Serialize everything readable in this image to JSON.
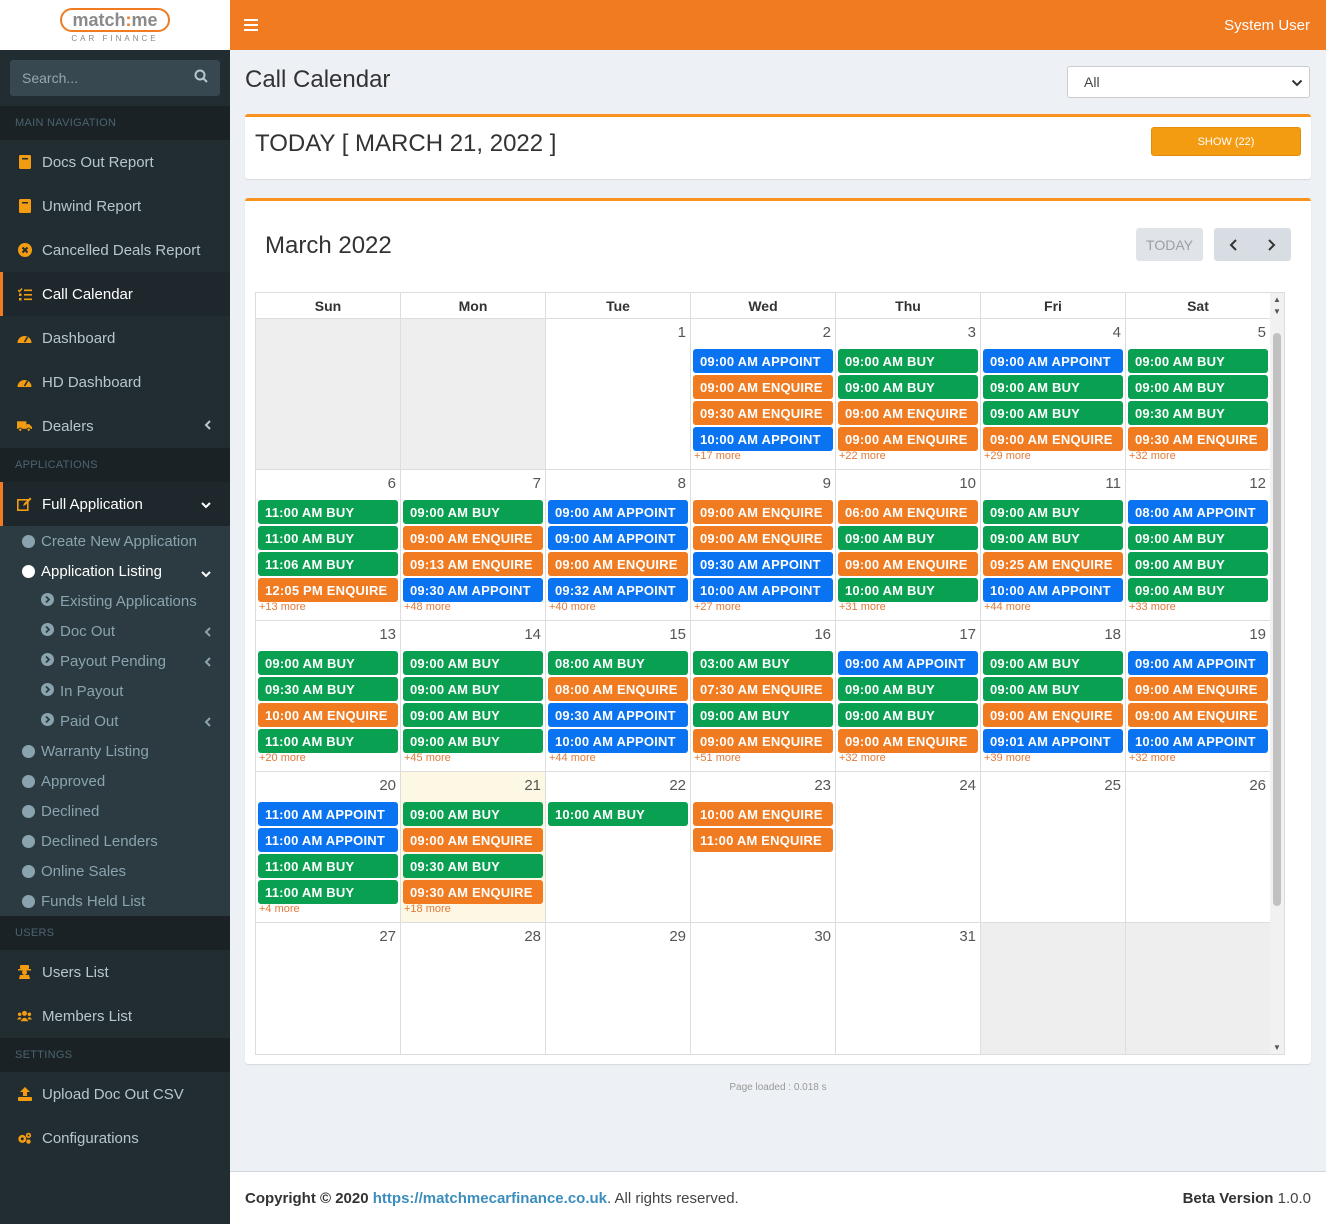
{
  "brand": {
    "name_left": "match",
    "name_colon": ":",
    "name_right": "me",
    "tagline": "CAR FINANCE"
  },
  "header": {
    "menu_icon": "hamburger-icon",
    "user": "System User"
  },
  "sidebar": {
    "search_placeholder": "Search...",
    "sections": {
      "main": "MAIN NAVIGATION",
      "applications": "APPLICATIONS",
      "users": "USERS",
      "settings": "SETTINGS"
    },
    "main_items": [
      {
        "label": "Docs Out Report",
        "icon": "book-icon"
      },
      {
        "label": "Unwind Report",
        "icon": "book-icon"
      },
      {
        "label": "Cancelled Deals Report",
        "icon": "times-circle-icon"
      },
      {
        "label": "Call Calendar",
        "icon": "list-check-icon"
      },
      {
        "label": "Dashboard",
        "icon": "gauge-icon"
      },
      {
        "label": "HD Dashboard",
        "icon": "gauge-icon"
      },
      {
        "label": "Dealers",
        "icon": "truck-icon"
      }
    ],
    "app_item": {
      "label": "Full Application",
      "icon": "edit-icon"
    },
    "app_sub": [
      "Create New Application",
      "Application Listing",
      "Existing Applications",
      "Doc Out",
      "Payout Pending",
      "In Payout",
      "Paid Out",
      "Warranty Listing",
      "Approved",
      "Declined",
      "Declined Lenders",
      "Online Sales",
      "Funds Held List"
    ],
    "users_items": [
      {
        "label": "Users List",
        "icon": "user-secret-icon"
      },
      {
        "label": "Members List",
        "icon": "users-icon"
      }
    ],
    "settings_items": [
      {
        "label": "Upload Doc Out CSV",
        "icon": "upload-icon"
      },
      {
        "label": "Configurations",
        "icon": "cogs-icon"
      }
    ]
  },
  "page": {
    "title": "Call Calendar",
    "filter_value": "All",
    "today_title": "TODAY [ MARCH 21, 2022 ]",
    "show_button": "SHOW (22)",
    "calendar_title": "March 2022",
    "today_button": "TODAY",
    "page_loaded": "Page loaded : 0.018 s"
  },
  "calendar": {
    "days_of_week": [
      "Sun",
      "Mon",
      "Tue",
      "Wed",
      "Thu",
      "Fri",
      "Sat"
    ],
    "weeks": [
      [
        {
          "n": "",
          "other": true,
          "events": []
        },
        {
          "n": "",
          "other": true,
          "events": []
        },
        {
          "n": "1",
          "events": []
        },
        {
          "n": "2",
          "events": [
            [
              "09:00 AM APPOINT",
              "blue"
            ],
            [
              "09:00 AM ENQUIRE",
              "orange"
            ],
            [
              "09:30 AM ENQUIRE",
              "orange"
            ],
            [
              "10:00 AM APPOINT",
              "blue"
            ]
          ],
          "more": "+17 more"
        },
        {
          "n": "3",
          "events": [
            [
              "09:00 AM BUY",
              "green"
            ],
            [
              "09:00 AM BUY",
              "green"
            ],
            [
              "09:00 AM ENQUIRE",
              "orange"
            ],
            [
              "09:00 AM ENQUIRE",
              "orange"
            ]
          ],
          "more": "+22 more"
        },
        {
          "n": "4",
          "events": [
            [
              "09:00 AM APPOINT",
              "blue"
            ],
            [
              "09:00 AM BUY",
              "green"
            ],
            [
              "09:00 AM BUY",
              "green"
            ],
            [
              "09:00 AM ENQUIRE",
              "orange"
            ]
          ],
          "more": "+29 more"
        },
        {
          "n": "5",
          "events": [
            [
              "09:00 AM BUY",
              "green"
            ],
            [
              "09:00 AM BUY",
              "green"
            ],
            [
              "09:30 AM BUY",
              "green"
            ],
            [
              "09:30 AM ENQUIRE",
              "orange"
            ]
          ],
          "more": "+32 more"
        }
      ],
      [
        {
          "n": "6",
          "events": [
            [
              "11:00 AM BUY",
              "green"
            ],
            [
              "11:00 AM BUY",
              "green"
            ],
            [
              "11:06 AM BUY",
              "green"
            ],
            [
              "12:05 PM ENQUIRE",
              "orange"
            ]
          ],
          "more": "+13 more"
        },
        {
          "n": "7",
          "events": [
            [
              "09:00 AM BUY",
              "green"
            ],
            [
              "09:00 AM ENQUIRE",
              "orange"
            ],
            [
              "09:13 AM ENQUIRE",
              "orange"
            ],
            [
              "09:30 AM APPOINT",
              "blue"
            ]
          ],
          "more": "+48 more"
        },
        {
          "n": "8",
          "events": [
            [
              "09:00 AM APPOINT",
              "blue"
            ],
            [
              "09:00 AM APPOINT",
              "blue"
            ],
            [
              "09:00 AM ENQUIRE",
              "orange"
            ],
            [
              "09:32 AM APPOINT",
              "blue"
            ]
          ],
          "more": "+40 more"
        },
        {
          "n": "9",
          "events": [
            [
              "09:00 AM ENQUIRE",
              "orange"
            ],
            [
              "09:00 AM ENQUIRE",
              "orange"
            ],
            [
              "09:30 AM APPOINT",
              "blue"
            ],
            [
              "10:00 AM APPOINT",
              "blue"
            ]
          ],
          "more": "+27 more"
        },
        {
          "n": "10",
          "events": [
            [
              "06:00 AM ENQUIRE",
              "orange"
            ],
            [
              "09:00 AM BUY",
              "green"
            ],
            [
              "09:00 AM ENQUIRE",
              "orange"
            ],
            [
              "10:00 AM BUY",
              "green"
            ]
          ],
          "more": "+31 more"
        },
        {
          "n": "11",
          "events": [
            [
              "09:00 AM BUY",
              "green"
            ],
            [
              "09:00 AM BUY",
              "green"
            ],
            [
              "09:25 AM ENQUIRE",
              "orange"
            ],
            [
              "10:00 AM APPOINT",
              "blue"
            ]
          ],
          "more": "+44 more"
        },
        {
          "n": "12",
          "events": [
            [
              "08:00 AM APPOINT",
              "blue"
            ],
            [
              "09:00 AM BUY",
              "green"
            ],
            [
              "09:00 AM BUY",
              "green"
            ],
            [
              "09:00 AM BUY",
              "green"
            ]
          ],
          "more": "+33 more"
        }
      ],
      [
        {
          "n": "13",
          "events": [
            [
              "09:00 AM BUY",
              "green"
            ],
            [
              "09:30 AM BUY",
              "green"
            ],
            [
              "10:00 AM ENQUIRE",
              "orange"
            ],
            [
              "11:00 AM BUY",
              "green"
            ]
          ],
          "more": "+20 more"
        },
        {
          "n": "14",
          "events": [
            [
              "09:00 AM BUY",
              "green"
            ],
            [
              "09:00 AM BUY",
              "green"
            ],
            [
              "09:00 AM BUY",
              "green"
            ],
            [
              "09:00 AM BUY",
              "green"
            ]
          ],
          "more": "+45 more"
        },
        {
          "n": "15",
          "events": [
            [
              "08:00 AM BUY",
              "green"
            ],
            [
              "08:00 AM ENQUIRE",
              "orange"
            ],
            [
              "09:30 AM APPOINT",
              "blue"
            ],
            [
              "10:00 AM APPOINT",
              "blue"
            ]
          ],
          "more": "+44 more"
        },
        {
          "n": "16",
          "events": [
            [
              "03:00 AM BUY",
              "green"
            ],
            [
              "07:30 AM ENQUIRE",
              "orange"
            ],
            [
              "09:00 AM BUY",
              "green"
            ],
            [
              "09:00 AM ENQUIRE",
              "orange"
            ]
          ],
          "more": "+51 more"
        },
        {
          "n": "17",
          "events": [
            [
              "09:00 AM APPOINT",
              "blue"
            ],
            [
              "09:00 AM BUY",
              "green"
            ],
            [
              "09:00 AM BUY",
              "green"
            ],
            [
              "09:00 AM ENQUIRE",
              "orange"
            ]
          ],
          "more": "+32 more"
        },
        {
          "n": "18",
          "events": [
            [
              "09:00 AM BUY",
              "green"
            ],
            [
              "09:00 AM BUY",
              "green"
            ],
            [
              "09:00 AM ENQUIRE",
              "orange"
            ],
            [
              "09:01 AM APPOINT",
              "blue"
            ]
          ],
          "more": "+39 more"
        },
        {
          "n": "19",
          "events": [
            [
              "09:00 AM APPOINT",
              "blue"
            ],
            [
              "09:00 AM ENQUIRE",
              "orange"
            ],
            [
              "09:00 AM ENQUIRE",
              "orange"
            ],
            [
              "10:00 AM APPOINT",
              "blue"
            ]
          ],
          "more": "+32 more"
        }
      ],
      [
        {
          "n": "20",
          "events": [
            [
              "11:00 AM APPOINT",
              "blue"
            ],
            [
              "11:00 AM APPOINT",
              "blue"
            ],
            [
              "11:00 AM BUY",
              "green"
            ],
            [
              "11:00 AM BUY",
              "green"
            ]
          ],
          "more": "+4 more"
        },
        {
          "n": "21",
          "today": true,
          "events": [
            [
              "09:00 AM BUY",
              "green"
            ],
            [
              "09:00 AM ENQUIRE",
              "orange"
            ],
            [
              "09:30 AM BUY",
              "green"
            ],
            [
              "09:30 AM ENQUIRE",
              "orange"
            ]
          ],
          "more": "+18 more"
        },
        {
          "n": "22",
          "events": [
            [
              "10:00 AM BUY",
              "green"
            ]
          ]
        },
        {
          "n": "23",
          "events": [
            [
              "10:00 AM ENQUIRE",
              "orange"
            ],
            [
              "11:00 AM ENQUIRE",
              "orange"
            ]
          ]
        },
        {
          "n": "24",
          "events": []
        },
        {
          "n": "25",
          "events": []
        },
        {
          "n": "26",
          "events": []
        }
      ],
      [
        {
          "n": "27",
          "events": []
        },
        {
          "n": "28",
          "events": []
        },
        {
          "n": "29",
          "events": []
        },
        {
          "n": "30",
          "events": []
        },
        {
          "n": "31",
          "events": []
        },
        {
          "n": "",
          "other": true,
          "events": []
        },
        {
          "n": "",
          "other": true,
          "events": []
        }
      ]
    ]
  },
  "footer": {
    "copyright": "Copyright © 2020",
    "link": "https://matchmecarfinance.co.uk",
    "rights": ". All rights reserved.",
    "version_label": "Beta Version",
    "version": "1.0.0"
  },
  "colors": {
    "accent": "#f07b21",
    "blue": "#0a73f2",
    "green": "#0aa051",
    "orange": "#f07b21",
    "sidebar": "#222d32"
  }
}
